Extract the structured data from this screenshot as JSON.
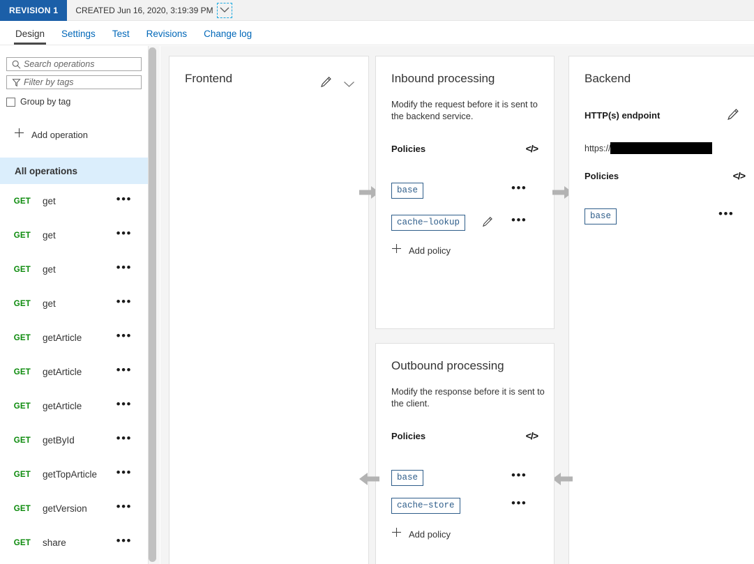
{
  "revision": {
    "badge": "REVISION 1",
    "created": "CREATED Jun 16, 2020, 3:19:39 PM",
    "chevron_icon": "chevron-down-icon",
    "badge_color": "#1b5fa8"
  },
  "tabs": [
    {
      "label": "Design",
      "active": true
    },
    {
      "label": "Settings",
      "active": false
    },
    {
      "label": "Test",
      "active": false
    },
    {
      "label": "Revisions",
      "active": false
    },
    {
      "label": "Change log",
      "active": false
    }
  ],
  "sidebar": {
    "search": {
      "placeholder": "Search operations",
      "value": "",
      "icon": "search-icon"
    },
    "filter": {
      "placeholder": "Filter by tags",
      "value": "",
      "icon": "filter-icon"
    },
    "group_by_tag": {
      "label": "Group by tag",
      "checked": false
    },
    "add_operation": {
      "label": "Add operation",
      "icon": "plus-icon"
    },
    "all_operations": {
      "label": "All operations",
      "selected": true,
      "background": "#dbeefc"
    },
    "verb_color": "#0b8a0b",
    "operations": [
      {
        "verb": "GET",
        "name": "get"
      },
      {
        "verb": "GET",
        "name": "get"
      },
      {
        "verb": "GET",
        "name": "get"
      },
      {
        "verb": "GET",
        "name": "get"
      },
      {
        "verb": "GET",
        "name": "getArticle"
      },
      {
        "verb": "GET",
        "name": "getArticle"
      },
      {
        "verb": "GET",
        "name": "getArticle"
      },
      {
        "verb": "GET",
        "name": "getById"
      },
      {
        "verb": "GET",
        "name": "getTopArticle"
      },
      {
        "verb": "GET",
        "name": "getVersion"
      },
      {
        "verb": "GET",
        "name": "share"
      }
    ],
    "row_menu_icon": "ellipsis-icon"
  },
  "frontend": {
    "title": "Frontend",
    "edit_icon": "pencil-icon",
    "expand_icon": "chevron-down-icon"
  },
  "inbound": {
    "title": "Inbound processing",
    "description": "Modify the request before it is sent to the backend service.",
    "policies_label": "Policies",
    "code_icon": "code-view-icon",
    "policies": [
      {
        "name": "base",
        "has_edit": false
      },
      {
        "name": "cache−lookup",
        "has_edit": true
      }
    ],
    "add_policy": {
      "label": "Add policy",
      "icon": "plus-icon"
    }
  },
  "outbound": {
    "title": "Outbound processing",
    "description": "Modify the response before it is sent to the client.",
    "policies_label": "Policies",
    "code_icon": "code-view-icon",
    "policies": [
      {
        "name": "base",
        "has_edit": false
      },
      {
        "name": "cache−store",
        "has_edit": false
      }
    ],
    "add_policy": {
      "label": "Add policy",
      "icon": "plus-icon"
    }
  },
  "backend": {
    "title": "Backend",
    "endpoint_label": "HTTP(s) endpoint",
    "edit_icon": "pencil-icon",
    "endpoint_url_prefix": "https://",
    "endpoint_url_redacted": true,
    "policies_label": "Policies",
    "code_icon": "code-view-icon",
    "policies": [
      {
        "name": "base",
        "has_edit": false
      }
    ]
  },
  "arrows": {
    "inbound_in": "arrow-right-icon",
    "inbound_out": "arrow-right-icon",
    "outbound_left": "arrow-left-icon",
    "outbound_in": "arrow-left-icon",
    "color": "#b3b3b3"
  }
}
